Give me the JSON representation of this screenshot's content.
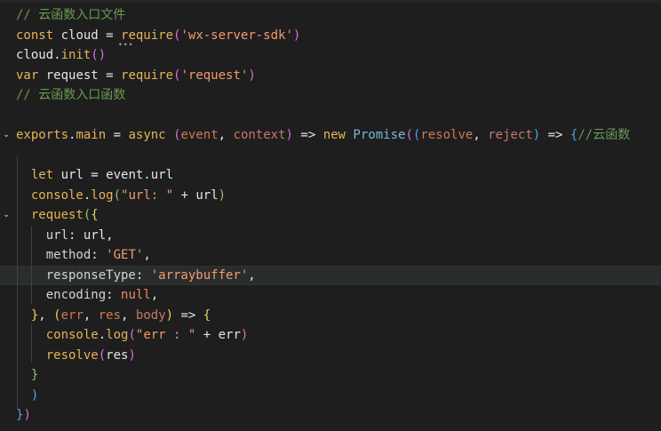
{
  "editor": {
    "language": "javascript",
    "lines": [
      {
        "n": 1,
        "tokens": [
          [
            "tok-comment",
            "// 云函数入口文件"
          ]
        ]
      },
      {
        "n": 2,
        "tokens": [
          [
            "tok-kw",
            "const"
          ],
          [
            "tok-var",
            " cloud = "
          ],
          [
            "tok-fn",
            "require"
          ],
          [
            "tok-b2",
            "("
          ],
          [
            "tok-str",
            "'wx-server-sdk'"
          ],
          [
            "tok-b2",
            ")"
          ]
        ]
      },
      {
        "n": 3,
        "tokens": [
          [
            "tok-var",
            "cloud."
          ],
          [
            "tok-fn",
            "init"
          ],
          [
            "tok-b2",
            "()"
          ]
        ]
      },
      {
        "n": 4,
        "tokens": [
          [
            "tok-kw",
            "var"
          ],
          [
            "tok-var",
            " request = "
          ],
          [
            "tok-fn",
            "require"
          ],
          [
            "tok-b2",
            "("
          ],
          [
            "tok-str",
            "'request'"
          ],
          [
            "tok-b2",
            ")"
          ]
        ]
      },
      {
        "n": 5,
        "tokens": [
          [
            "tok-comment",
            "// 云函数入口函数"
          ]
        ]
      },
      {
        "n": 6,
        "tokens": []
      },
      {
        "n": 7,
        "tokens": [
          [
            "tok-fn",
            "exports"
          ],
          [
            "tok-var",
            "."
          ],
          [
            "tok-fn",
            "main"
          ],
          [
            "tok-var",
            " = "
          ],
          [
            "tok-kw",
            "async"
          ],
          [
            "tok-var",
            " "
          ],
          [
            "tok-b2",
            "("
          ],
          [
            "tok-param",
            "event"
          ],
          [
            "tok-var",
            ", "
          ],
          [
            "tok-param2",
            "context"
          ],
          [
            "tok-b2",
            ")"
          ],
          [
            "tok-var",
            " => "
          ],
          [
            "tok-kw",
            "new"
          ],
          [
            "tok-var",
            " "
          ],
          [
            "tok-cls",
            "Promise"
          ],
          [
            "tok-b2",
            "("
          ],
          [
            "tok-b3",
            "("
          ],
          [
            "tok-param",
            "resolve"
          ],
          [
            "tok-var",
            ", "
          ],
          [
            "tok-param2",
            "reject"
          ],
          [
            "tok-b3",
            ")"
          ],
          [
            "tok-var",
            " => "
          ],
          [
            "tok-b3",
            "{"
          ],
          [
            "tok-comment",
            "//云函数"
          ]
        ]
      },
      {
        "n": 8,
        "tokens": []
      },
      {
        "n": 9,
        "tokens": [
          [
            "tok-kw",
            "  let"
          ],
          [
            "tok-var",
            " url = event.url"
          ]
        ]
      },
      {
        "n": 10,
        "tokens": [
          [
            "tok-fn",
            "  console"
          ],
          [
            "tok-var",
            "."
          ],
          [
            "tok-fn",
            "log"
          ],
          [
            "tok-b4",
            "("
          ],
          [
            "tok-str",
            "\"url: \""
          ],
          [
            "tok-var",
            " + url"
          ],
          [
            "tok-b4",
            ")"
          ]
        ]
      },
      {
        "n": 11,
        "tokens": [
          [
            "tok-fn",
            "  request"
          ],
          [
            "tok-b4",
            "("
          ],
          [
            "tok-b1",
            "{"
          ]
        ]
      },
      {
        "n": 12,
        "tokens": [
          [
            "tok-prop",
            "    url"
          ],
          [
            "tok-var",
            ": url,"
          ]
        ]
      },
      {
        "n": 13,
        "tokens": [
          [
            "tok-prop",
            "    method"
          ],
          [
            "tok-var",
            ": "
          ],
          [
            "tok-str",
            "'GET'"
          ],
          [
            "tok-var",
            ","
          ]
        ]
      },
      {
        "n": 14,
        "tokens": [
          [
            "tok-prop",
            "    responseType"
          ],
          [
            "tok-var",
            ": "
          ],
          [
            "tok-str",
            "'arraybuffer'"
          ],
          [
            "tok-var",
            ","
          ]
        ],
        "highlight": true
      },
      {
        "n": 15,
        "tokens": [
          [
            "tok-prop",
            "    encoding"
          ],
          [
            "tok-var",
            ": "
          ],
          [
            "tok-null",
            "null"
          ],
          [
            "tok-var",
            ","
          ]
        ]
      },
      {
        "n": 16,
        "tokens": [
          [
            "tok-b1",
            "  }"
          ],
          [
            "tok-var",
            ", "
          ],
          [
            "tok-b1",
            "("
          ],
          [
            "tok-param",
            "err"
          ],
          [
            "tok-var",
            ", "
          ],
          [
            "tok-param",
            "res"
          ],
          [
            "tok-var",
            ", "
          ],
          [
            "tok-param2",
            "body"
          ],
          [
            "tok-b1",
            ")"
          ],
          [
            "tok-var",
            " => "
          ],
          [
            "tok-b1",
            "{"
          ]
        ]
      },
      {
        "n": 17,
        "tokens": [
          [
            "tok-fn",
            "    console"
          ],
          [
            "tok-var",
            "."
          ],
          [
            "tok-fn",
            "log"
          ],
          [
            "tok-b2",
            "("
          ],
          [
            "tok-str",
            "\"err : \""
          ],
          [
            "tok-var",
            " + err"
          ],
          [
            "tok-b2",
            ")"
          ]
        ]
      },
      {
        "n": 18,
        "tokens": [
          [
            "tok-fn",
            "    resolve"
          ],
          [
            "tok-b2",
            "("
          ],
          [
            "tok-var",
            "res"
          ],
          [
            "tok-b2",
            ")"
          ]
        ]
      },
      {
        "n": 19,
        "tokens": [
          [
            "tok-b4",
            "  }"
          ]
        ]
      },
      {
        "n": 20,
        "tokens": [
          [
            "tok-b3",
            "  )"
          ]
        ]
      },
      {
        "n": 21,
        "tokens": [
          [
            "tok-b3",
            "}"
          ],
          [
            "tok-b2",
            ")"
          ]
        ]
      }
    ],
    "fold_markers": [
      {
        "line": 7,
        "icon": "chevron-down-icon",
        "glyph": "⌄"
      },
      {
        "line": 11,
        "icon": "chevron-down-icon",
        "glyph": "⌄"
      }
    ]
  }
}
